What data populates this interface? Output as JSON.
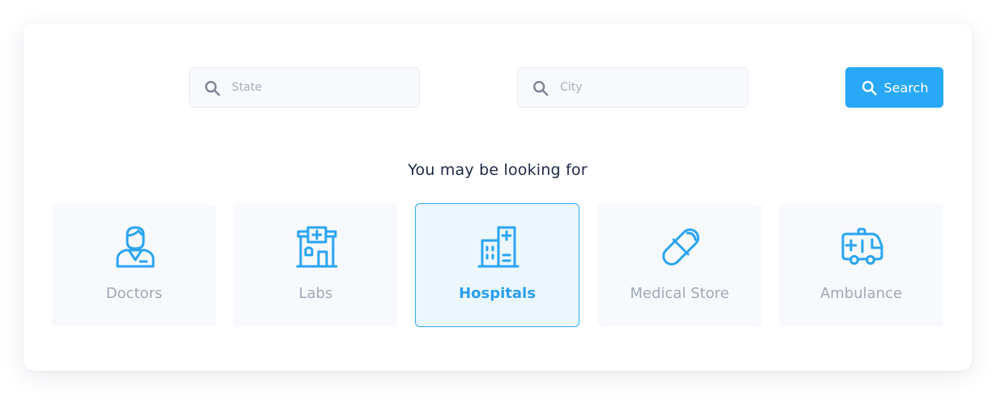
{
  "search": {
    "state_placeholder": "State",
    "city_placeholder": "City",
    "button_label": "Search"
  },
  "section": {
    "heading": "You may be looking for"
  },
  "categories": [
    {
      "label": "Doctors",
      "icon": "doctor-icon",
      "active": false
    },
    {
      "label": "Labs",
      "icon": "lab-building-icon",
      "active": false
    },
    {
      "label": "Hospitals",
      "icon": "hospital-icon",
      "active": true
    },
    {
      "label": "Medical Store",
      "icon": "pill-capsule-icon",
      "active": false
    },
    {
      "label": "Ambulance",
      "icon": "ambulance-icon",
      "active": false
    }
  ],
  "colors": {
    "accent": "#28a8f7",
    "icon_blue": "#2aa4f4",
    "active_bg": "#ebf6fd",
    "muted_text": "#a0a8b8",
    "heading_text": "#1e2845"
  }
}
